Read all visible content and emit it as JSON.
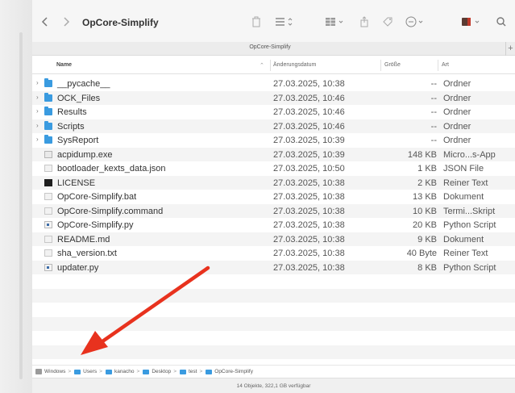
{
  "window": {
    "title": "OpCore-Simplify",
    "tab_title": "OpCore-Simplify",
    "tab_plus": "+"
  },
  "toolbar": {
    "back_icon": "chevron-left-icon",
    "forward_icon": "chevron-right-icon",
    "trash_icon": "trash-icon",
    "list_view_icon": "list-view-icon",
    "grid_view_icon": "grid-view-icon",
    "share_icon": "share-icon",
    "tag_icon": "tag-icon",
    "action_icon": "ellipsis-circle-icon",
    "app_icon": "app-icon",
    "search_icon": "search-icon"
  },
  "columns": {
    "name": "Name",
    "date": "Änderungsdatum",
    "size": "Größe",
    "kind": "Art"
  },
  "files": [
    {
      "name": "__pycache__",
      "date": "27.03.2025, 10:38",
      "size": "--",
      "kind": "Ordner",
      "type": "folder"
    },
    {
      "name": "OCK_Files",
      "date": "27.03.2025, 10:46",
      "size": "--",
      "kind": "Ordner",
      "type": "folder"
    },
    {
      "name": "Results",
      "date": "27.03.2025, 10:46",
      "size": "--",
      "kind": "Ordner",
      "type": "folder"
    },
    {
      "name": "Scripts",
      "date": "27.03.2025, 10:46",
      "size": "--",
      "kind": "Ordner",
      "type": "folder"
    },
    {
      "name": "SysReport",
      "date": "27.03.2025, 10:39",
      "size": "--",
      "kind": "Ordner",
      "type": "folder"
    },
    {
      "name": "acpidump.exe",
      "date": "27.03.2025, 10:39",
      "size": "148 KB",
      "kind": "Micro...s-App",
      "type": "bin"
    },
    {
      "name": "bootloader_kexts_data.json",
      "date": "27.03.2025, 10:50",
      "size": "1 KB",
      "kind": "JSON File",
      "type": "doc"
    },
    {
      "name": "LICENSE",
      "date": "27.03.2025, 10:38",
      "size": "2 KB",
      "kind": "Reiner Text",
      "type": "dark"
    },
    {
      "name": "OpCore-Simplify.bat",
      "date": "27.03.2025, 10:38",
      "size": "13 KB",
      "kind": "Dokument",
      "type": "doc"
    },
    {
      "name": "OpCore-Simplify.command",
      "date": "27.03.2025, 10:38",
      "size": "10 KB",
      "kind": "Termi...Skript",
      "type": "doc"
    },
    {
      "name": "OpCore-Simplify.py",
      "date": "27.03.2025, 10:38",
      "size": "20 KB",
      "kind": "Python Script",
      "type": "py"
    },
    {
      "name": "README.md",
      "date": "27.03.2025, 10:38",
      "size": "9 KB",
      "kind": "Dokument",
      "type": "doc"
    },
    {
      "name": "sha_version.txt",
      "date": "27.03.2025, 10:38",
      "size": "40 Byte",
      "kind": "Reiner Text",
      "type": "doc"
    },
    {
      "name": "updater.py",
      "date": "27.03.2025, 10:38",
      "size": "8 KB",
      "kind": "Python Script",
      "type": "py"
    }
  ],
  "pathbar": {
    "crumbs": [
      "Windows",
      "Users",
      "kanacho",
      "Desktop",
      "test",
      "OpCore-Simplify"
    ],
    "separator": ">"
  },
  "status": {
    "text": "14 Objekte, 322,1 GB verfügbar"
  },
  "colors": {
    "folder": "#3a9be0",
    "annotation_arrow": "#e8321e"
  }
}
